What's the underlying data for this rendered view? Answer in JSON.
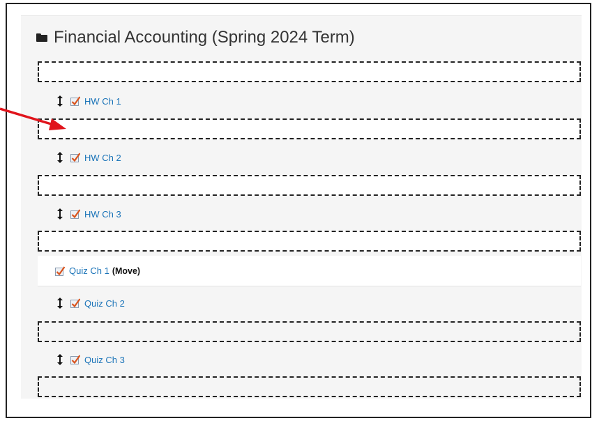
{
  "section": {
    "title": "Financial Accounting (Spring 2024 Term)"
  },
  "items": [
    {
      "label": "HW Ch 1"
    },
    {
      "label": "HW Ch 2"
    },
    {
      "label": "HW Ch 3"
    },
    {
      "label": "Quiz Ch 1",
      "move_label": "(Move)"
    },
    {
      "label": "Quiz Ch 2"
    },
    {
      "label": "Quiz Ch 3"
    }
  ],
  "icons": {
    "folder": "folder-icon",
    "drag_handle": "drag-handle-icon",
    "activity": "assignment-checkbox-icon",
    "annotation": "red-arrow-icon"
  },
  "colors": {
    "link": "#1a73b8",
    "annotation_arrow": "#e0141c",
    "icon_check": "#d9541e"
  }
}
